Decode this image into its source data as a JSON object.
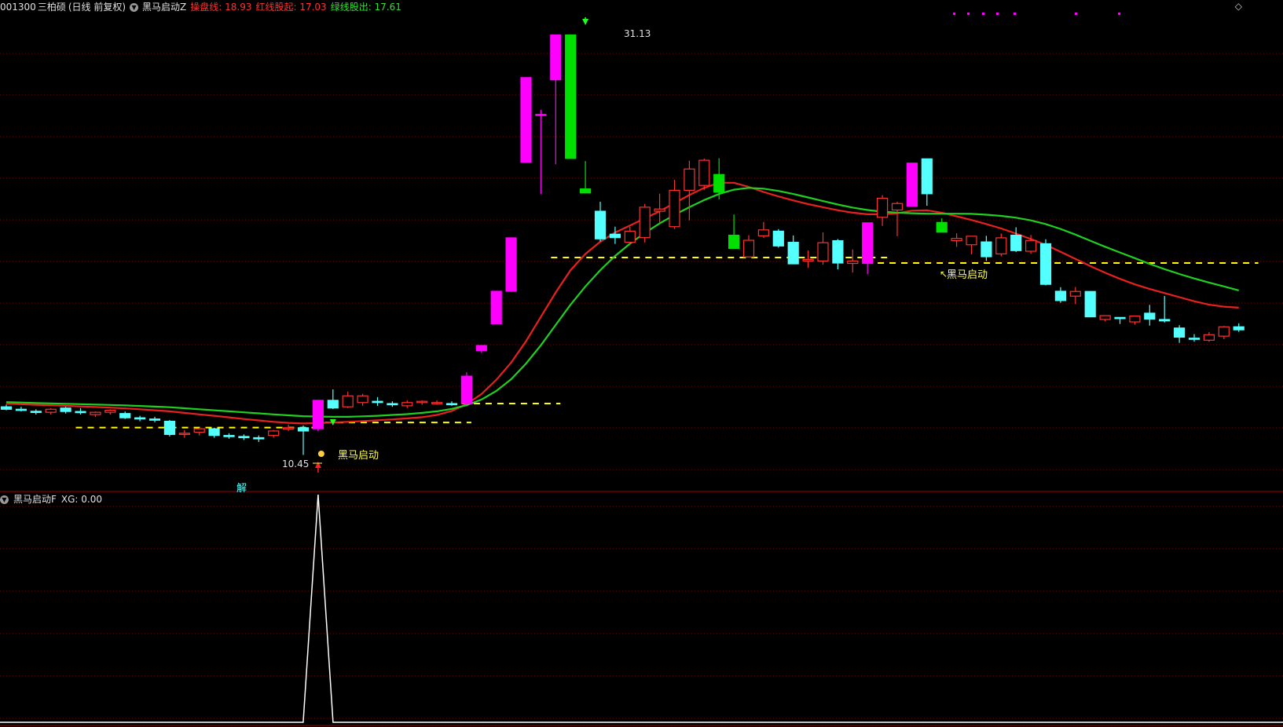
{
  "header": {
    "stock_code": "001300",
    "stock_name": "三柏硕",
    "period": "(日线 前复权)",
    "indicator_name": "黑马启动Z",
    "line1_label": "操盘线: 18.93",
    "line2_label": "红线股起: 17.03",
    "line3_label": "绿线股出: 17.61"
  },
  "sub_header": {
    "indicator_name": "黑马启动F",
    "xg_label": "XG: 0.00"
  },
  "annotations": {
    "peak_label": "31.13",
    "low_label": "10.45",
    "signal1": "黑马启动",
    "signal2": "黑马启动",
    "jie_tag": "解"
  },
  "colors": {
    "up_magenta": "#ff00ff",
    "up_red_outline": "#ff3030",
    "down_cyan": "#54ffff",
    "down_green": "#00e000",
    "ma_red": "#e82020",
    "ma_green": "#20d020",
    "dash_yellow": "#ffff00",
    "grid_red": "#7a0000",
    "sub_line": "#ffffff"
  },
  "chart_data": [
    {
      "type": "candlestick",
      "title": "",
      "xlabel": "",
      "ylabel": "",
      "ylim": [
        9.0,
        32.0
      ],
      "grid": true,
      "candles": [
        {
          "o": 12.82,
          "h": 12.93,
          "l": 12.65,
          "c": 12.7,
          "style": "cyan"
        },
        {
          "o": 12.7,
          "h": 12.82,
          "l": 12.59,
          "c": 12.65,
          "style": "cyan"
        },
        {
          "o": 12.6,
          "h": 12.7,
          "l": 12.44,
          "c": 12.55,
          "style": "cyan"
        },
        {
          "o": 12.55,
          "h": 12.75,
          "l": 12.44,
          "c": 12.7,
          "style": "redhollow"
        },
        {
          "o": 12.76,
          "h": 12.82,
          "l": 12.49,
          "c": 12.59,
          "style": "cyan"
        },
        {
          "o": 12.59,
          "h": 12.76,
          "l": 12.44,
          "c": 12.55,
          "style": "cyan"
        },
        {
          "o": 12.44,
          "h": 12.59,
          "l": 12.33,
          "c": 12.55,
          "style": "redhollow"
        },
        {
          "o": 12.55,
          "h": 12.7,
          "l": 12.44,
          "c": 12.65,
          "style": "redhollow"
        },
        {
          "o": 12.49,
          "h": 12.59,
          "l": 12.22,
          "c": 12.28,
          "style": "cyan"
        },
        {
          "o": 12.28,
          "h": 12.38,
          "l": 12.11,
          "c": 12.22,
          "style": "cyan"
        },
        {
          "o": 12.22,
          "h": 12.33,
          "l": 12.06,
          "c": 12.17,
          "style": "cyan"
        },
        {
          "o": 12.11,
          "h": 12.17,
          "l": 11.36,
          "c": 11.46,
          "style": "cyan"
        },
        {
          "o": 11.46,
          "h": 11.68,
          "l": 11.3,
          "c": 11.52,
          "style": "redhollow"
        },
        {
          "o": 11.57,
          "h": 11.79,
          "l": 11.41,
          "c": 11.74,
          "style": "redhollow"
        },
        {
          "o": 11.74,
          "h": 11.79,
          "l": 11.3,
          "c": 11.41,
          "style": "cyan"
        },
        {
          "o": 11.41,
          "h": 11.52,
          "l": 11.25,
          "c": 11.36,
          "style": "cyan"
        },
        {
          "o": 11.36,
          "h": 11.46,
          "l": 11.19,
          "c": 11.3,
          "style": "cyan"
        },
        {
          "o": 11.3,
          "h": 11.41,
          "l": 11.09,
          "c": 11.25,
          "style": "cyan"
        },
        {
          "o": 11.41,
          "h": 11.68,
          "l": 11.3,
          "c": 11.63,
          "style": "redhollow"
        },
        {
          "o": 11.74,
          "h": 11.95,
          "l": 11.63,
          "c": 11.79,
          "style": "redhollow"
        },
        {
          "o": 11.79,
          "h": 11.9,
          "l": 10.45,
          "c": 11.63,
          "style": "cyan"
        },
        {
          "o": 11.74,
          "h": 13.14,
          "l": 11.63,
          "c": 13.14,
          "style": "magenta"
        },
        {
          "o": 13.14,
          "h": 13.68,
          "l": 12.71,
          "c": 12.76,
          "style": "cyan"
        },
        {
          "o": 12.82,
          "h": 13.57,
          "l": 12.76,
          "c": 13.36,
          "style": "redhollow"
        },
        {
          "o": 13.03,
          "h": 13.46,
          "l": 12.87,
          "c": 13.36,
          "style": "redhollow"
        },
        {
          "o": 13.09,
          "h": 13.3,
          "l": 12.87,
          "c": 13.03,
          "style": "cyan"
        },
        {
          "o": 12.98,
          "h": 13.09,
          "l": 12.82,
          "c": 12.92,
          "style": "cyan"
        },
        {
          "o": 12.87,
          "h": 13.14,
          "l": 12.76,
          "c": 13.03,
          "style": "redhollow"
        },
        {
          "o": 13.03,
          "h": 13.14,
          "l": 12.92,
          "c": 13.09,
          "style": "redhollow"
        },
        {
          "o": 13.03,
          "h": 13.14,
          "l": 12.92,
          "c": 13.03,
          "style": "redhollow"
        },
        {
          "o": 12.98,
          "h": 13.09,
          "l": 12.87,
          "c": 12.98,
          "style": "cyan"
        },
        {
          "o": 12.98,
          "h": 14.52,
          "l": 12.98,
          "c": 14.33,
          "style": "magenta"
        },
        {
          "o": 15.59,
          "h": 15.84,
          "l": 15.48,
          "c": 15.84,
          "style": "magenta"
        },
        {
          "o": 16.91,
          "h": 18.51,
          "l": 16.91,
          "c": 18.51,
          "style": "magenta"
        },
        {
          "o": 18.51,
          "h": 21.14,
          "l": 18.51,
          "c": 21.14,
          "style": "magenta"
        },
        {
          "o": 24.86,
          "h": 29.03,
          "l": 24.86,
          "c": 29.03,
          "style": "magenta"
        },
        {
          "o": 27.22,
          "h": 27.44,
          "l": 23.3,
          "c": 27.22,
          "style": "magenta"
        },
        {
          "o": 28.92,
          "h": 31.13,
          "l": 24.76,
          "c": 31.13,
          "style": "magenta"
        },
        {
          "o": 31.13,
          "h": 31.13,
          "l": 25.05,
          "c": 25.05,
          "style": "green"
        },
        {
          "o": 23.55,
          "h": 24.92,
          "l": 23.35,
          "c": 23.35,
          "style": "green"
        },
        {
          "o": 22.45,
          "h": 22.92,
          "l": 20.96,
          "c": 21.09,
          "style": "cyan"
        },
        {
          "o": 21.32,
          "h": 21.69,
          "l": 20.84,
          "c": 21.15,
          "style": "cyan"
        },
        {
          "o": 20.92,
          "h": 21.68,
          "l": 20.77,
          "c": 21.47,
          "style": "redhollow"
        },
        {
          "o": 21.15,
          "h": 22.81,
          "l": 20.91,
          "c": 22.65,
          "style": "redhollow"
        },
        {
          "o": 22.45,
          "h": 23.31,
          "l": 21.86,
          "c": 22.56,
          "style": "redhollow"
        },
        {
          "o": 21.69,
          "h": 24.0,
          "l": 21.58,
          "c": 23.48,
          "style": "redhollow"
        },
        {
          "o": 23.48,
          "h": 24.94,
          "l": 22.0,
          "c": 24.53,
          "style": "redhollow"
        },
        {
          "o": 23.72,
          "h": 25.04,
          "l": 23.5,
          "c": 24.96,
          "style": "redhollow"
        },
        {
          "o": 24.26,
          "h": 25.06,
          "l": 23.03,
          "c": 23.39,
          "style": "green"
        },
        {
          "o": 21.27,
          "h": 22.29,
          "l": 20.62,
          "c": 20.62,
          "style": "green"
        },
        {
          "o": 20.2,
          "h": 21.27,
          "l": 20.2,
          "c": 21.02,
          "style": "redhollow"
        },
        {
          "o": 21.24,
          "h": 21.92,
          "l": 21.14,
          "c": 21.53,
          "style": "redhollow"
        },
        {
          "o": 21.47,
          "h": 21.57,
          "l": 20.66,
          "c": 20.74,
          "style": "cyan"
        },
        {
          "o": 20.92,
          "h": 21.26,
          "l": 19.84,
          "c": 19.86,
          "style": "cyan"
        },
        {
          "o": 20.0,
          "h": 20.52,
          "l": 19.66,
          "c": 20.08,
          "style": "redhollow"
        },
        {
          "o": 20.0,
          "h": 21.41,
          "l": 19.82,
          "c": 20.9,
          "style": "redhollow"
        },
        {
          "o": 21.0,
          "h": 21.08,
          "l": 19.59,
          "c": 19.9,
          "style": "cyan"
        },
        {
          "o": 20.0,
          "h": 20.57,
          "l": 19.43,
          "c": 19.88,
          "style": "redhollow"
        },
        {
          "o": 19.88,
          "h": 21.88,
          "l": 19.35,
          "c": 21.88,
          "style": "magenta"
        },
        {
          "o": 22.15,
          "h": 23.24,
          "l": 21.73,
          "c": 23.09,
          "style": "redhollow"
        },
        {
          "o": 22.51,
          "h": 22.92,
          "l": 21.22,
          "c": 22.83,
          "style": "redhollow"
        },
        {
          "o": 22.7,
          "h": 24.82,
          "l": 22.7,
          "c": 24.82,
          "style": "magenta"
        },
        {
          "o": 25.03,
          "h": 25.03,
          "l": 22.72,
          "c": 23.31,
          "style": "cyan"
        },
        {
          "o": 21.9,
          "h": 22.1,
          "l": 21.42,
          "c": 21.42,
          "style": "green"
        },
        {
          "o": 21.0,
          "h": 21.36,
          "l": 20.7,
          "c": 21.11,
          "style": "redhollow"
        },
        {
          "o": 20.8,
          "h": 21.22,
          "l": 20.33,
          "c": 21.22,
          "style": "redhollow"
        },
        {
          "o": 20.94,
          "h": 21.24,
          "l": 20.0,
          "c": 20.21,
          "style": "cyan"
        },
        {
          "o": 20.35,
          "h": 21.35,
          "l": 20.23,
          "c": 21.14,
          "style": "redhollow"
        },
        {
          "o": 21.27,
          "h": 21.66,
          "l": 20.44,
          "c": 20.51,
          "style": "cyan"
        },
        {
          "o": 20.48,
          "h": 21.28,
          "l": 20.35,
          "c": 21.01,
          "style": "redhollow"
        },
        {
          "o": 20.85,
          "h": 21.07,
          "l": 18.8,
          "c": 18.85,
          "style": "cyan"
        },
        {
          "o": 18.51,
          "h": 18.71,
          "l": 17.94,
          "c": 18.05,
          "style": "cyan"
        },
        {
          "o": 18.27,
          "h": 18.72,
          "l": 17.88,
          "c": 18.5,
          "style": "redhollow"
        },
        {
          "o": 18.5,
          "h": 18.5,
          "l": 17.25,
          "c": 17.25,
          "style": "cyan"
        },
        {
          "o": 17.31,
          "h": 17.31,
          "l": 17.04,
          "c": 17.12,
          "style": "redhollow"
        },
        {
          "o": 17.2,
          "h": 17.2,
          "l": 16.9,
          "c": 17.22,
          "style": "cyan"
        },
        {
          "o": 17.0,
          "h": 17.31,
          "l": 16.86,
          "c": 17.29,
          "style": "redhollow"
        },
        {
          "o": 17.14,
          "h": 17.84,
          "l": 16.82,
          "c": 17.43,
          "style": "cyan"
        },
        {
          "o": 17.05,
          "h": 18.28,
          "l": 16.97,
          "c": 17.12,
          "style": "cyan"
        },
        {
          "o": 16.7,
          "h": 16.84,
          "l": 15.97,
          "c": 16.25,
          "style": "cyan"
        },
        {
          "o": 16.2,
          "h": 16.4,
          "l": 16.03,
          "c": 16.16,
          "style": "cyan"
        },
        {
          "o": 16.1,
          "h": 16.5,
          "l": 16.02,
          "c": 16.37,
          "style": "redhollow"
        },
        {
          "o": 16.3,
          "h": 16.8,
          "l": 16.15,
          "c": 16.76,
          "style": "redhollow"
        },
        {
          "o": 16.76,
          "h": 16.93,
          "l": 16.51,
          "c": 16.61,
          "style": "cyan"
        }
      ],
      "series": [
        {
          "name": "",
          "values": [
            12.98,
            12.95,
            12.92,
            12.9,
            12.87,
            12.84,
            12.81,
            12.78,
            12.74,
            12.7,
            12.65,
            12.6,
            12.52,
            12.45,
            12.38,
            12.3,
            12.22,
            12.15,
            12.08,
            12.03,
            12.0,
            12.02,
            12.05,
            12.08,
            12.12,
            12.16,
            12.2,
            12.25,
            12.31,
            12.42,
            12.62,
            12.95,
            13.45,
            14.15,
            15.0,
            16.05,
            17.25,
            18.45,
            19.55,
            20.35,
            20.95,
            21.4,
            21.75,
            22.1,
            22.45,
            22.85,
            23.25,
            23.6,
            23.85,
            23.85,
            23.65,
            23.4,
            23.18,
            22.98,
            22.8,
            22.65,
            22.5,
            22.38,
            22.3,
            22.3,
            22.35,
            22.48,
            22.5,
            22.38,
            22.2,
            22.02,
            21.82,
            21.6,
            21.35,
            21.08,
            20.8,
            20.45,
            20.1,
            19.75,
            19.42,
            19.12,
            18.85,
            18.62,
            18.42,
            18.22,
            18.02,
            17.85,
            17.75,
            17.7
          ]
        },
        {
          "name": "",
          "values": [
            13.05,
            13.03,
            13.01,
            12.99,
            12.97,
            12.95,
            12.93,
            12.91,
            12.89,
            12.86,
            12.83,
            12.8,
            12.75,
            12.7,
            12.65,
            12.6,
            12.55,
            12.5,
            12.45,
            12.4,
            12.36,
            12.34,
            12.33,
            12.33,
            12.35,
            12.38,
            12.42,
            12.46,
            12.52,
            12.6,
            12.72,
            12.9,
            13.18,
            13.6,
            14.18,
            14.95,
            15.85,
            16.85,
            17.85,
            18.75,
            19.55,
            20.25,
            20.85,
            21.38,
            21.85,
            22.27,
            22.65,
            23.0,
            23.3,
            23.51,
            23.6,
            23.56,
            23.45,
            23.3,
            23.13,
            22.95,
            22.78,
            22.63,
            22.51,
            22.43,
            22.38,
            22.35,
            22.33,
            22.33,
            22.33,
            22.32,
            22.28,
            22.22,
            22.13,
            22.0,
            21.82,
            21.58,
            21.3,
            21.0,
            20.7,
            20.42,
            20.14,
            19.86,
            19.6,
            19.36,
            19.14,
            18.94,
            18.75,
            18.55
          ]
        }
      ],
      "levels": [
        {
          "value": 20.17,
          "from": 37,
          "to": 59
        },
        {
          "value": 19.9,
          "from": 59,
          "to": 84
        },
        {
          "value": 12.98,
          "from": 31,
          "to": 37
        },
        {
          "value": 12.05,
          "from": 21,
          "to": 31
        },
        {
          "value": 11.8,
          "from": 5,
          "to": 21
        }
      ]
    },
    {
      "type": "line",
      "title": "",
      "xlabel": "",
      "ylabel": "",
      "ylim": [
        0,
        1
      ],
      "grid": true,
      "series": [
        {
          "name": "XG",
          "spike_index": 21,
          "spike_value": 1.0,
          "base_value": 0.0
        }
      ]
    }
  ]
}
